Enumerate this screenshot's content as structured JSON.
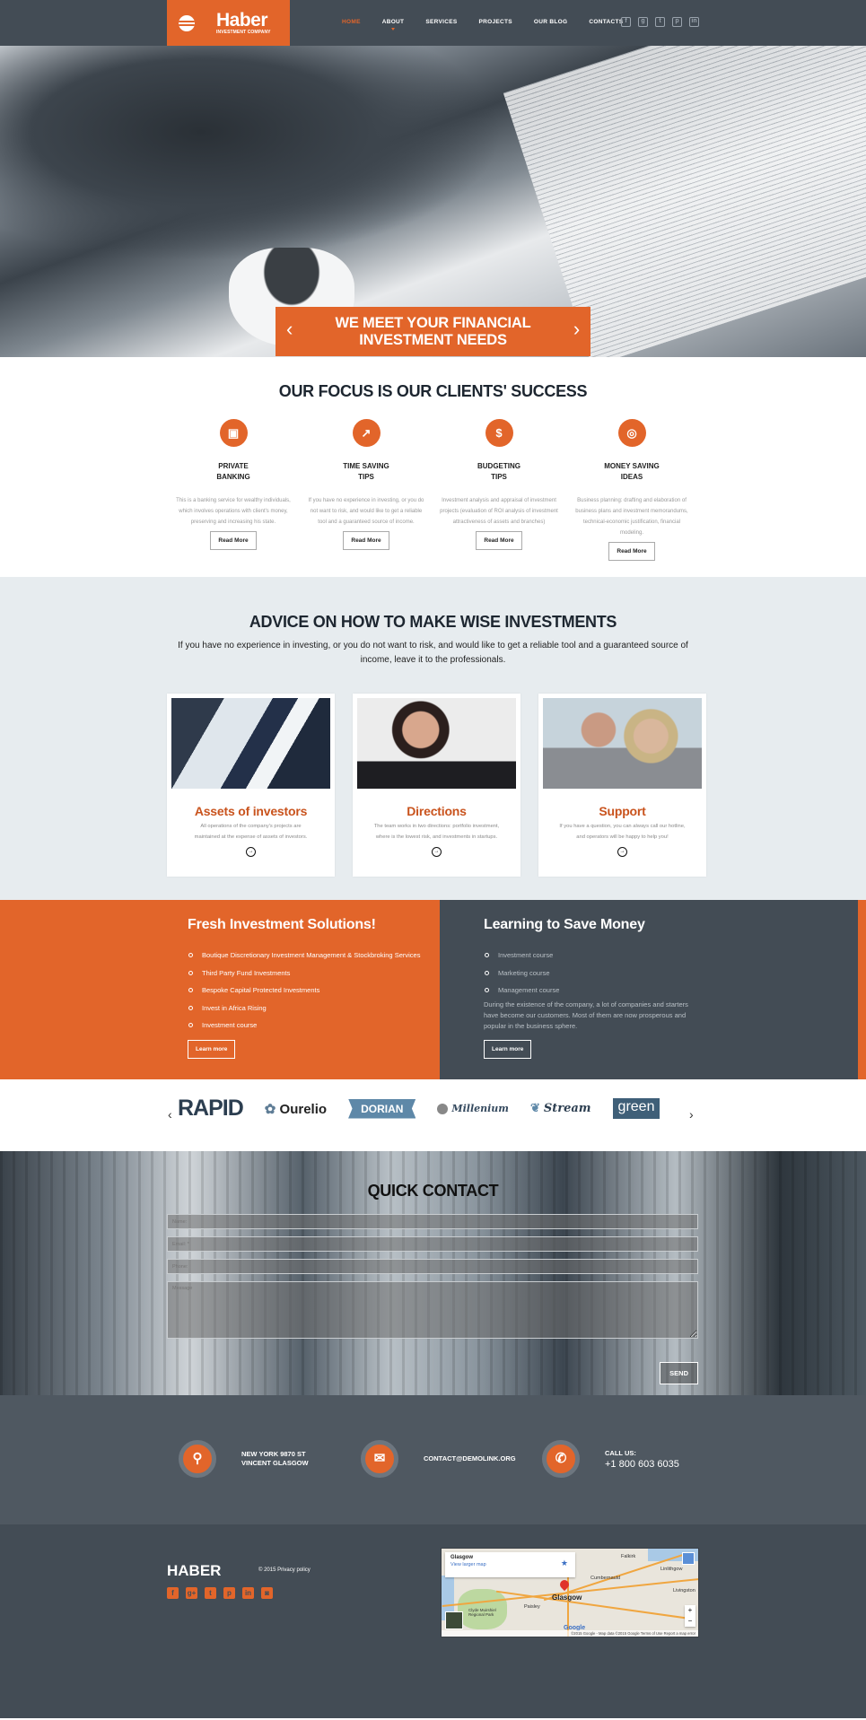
{
  "header": {
    "brand_name": "Haber",
    "brand_tagline": "INVESTMENT COMPANY",
    "nav": [
      {
        "label": "HOME",
        "active": true
      },
      {
        "label": "ABOUT",
        "active": false
      },
      {
        "label": "SERVICES",
        "active": false
      },
      {
        "label": "PROJECTS",
        "active": false
      },
      {
        "label": "OUR BLOG",
        "active": false
      },
      {
        "label": "CONTACTS",
        "active": false
      }
    ],
    "social": [
      {
        "icon": "facebook-icon",
        "glyph": "f"
      },
      {
        "icon": "google-plus-icon",
        "glyph": "g"
      },
      {
        "icon": "twitter-icon",
        "glyph": "t"
      },
      {
        "icon": "pinterest-icon",
        "glyph": "p"
      },
      {
        "icon": "linkedin-icon",
        "glyph": "in"
      }
    ]
  },
  "hero": {
    "banner_line1": "WE MEET YOUR FINANCIAL",
    "banner_line2": "INVESTMENT NEEDS",
    "prev_glyph": "‹",
    "next_glyph": "›"
  },
  "focus": {
    "title": "OUR FOCUS IS OUR CLIENTS' SUCCESS",
    "features": [
      {
        "icon": "wallet-icon",
        "glyph": "▣",
        "title_line1": "PRIVATE",
        "title_line2": "BANKING",
        "text": "This is a banking service for wealthy individuals, which involves operations with client's money, preserving and increasing his state.",
        "button": "Read More"
      },
      {
        "icon": "chart-growth-icon",
        "glyph": "↗",
        "title_line1": "TIME SAVING",
        "title_line2": "TIPS",
        "text": "If you have no experience in investing, or you do not want to risk, and would like to get a reliable tool and a guaranteed source of income.",
        "button": "Read More"
      },
      {
        "icon": "money-bag-icon",
        "glyph": "$",
        "title_line1": "BUDGETING",
        "title_line2": "TIPS",
        "text": "Investment analysis and appraisal of investment projects (evaluation of ROI analysis of investment attractiveness of assets and branches)",
        "button": "Read More"
      },
      {
        "icon": "coins-icon",
        "glyph": "◎",
        "title_line1": "MONEY SAVING",
        "title_line2": "IDEAS",
        "text": "Business planning: drafting and elaboration of business plans and investment memorandums, technical-economic justification, financial modeling.",
        "button": "Read More"
      }
    ]
  },
  "advice": {
    "title": "ADVICE ON HOW TO MAKE WISE INVESTMENTS",
    "subtitle": "If you have no experience in investing, or you do not want to risk, and would like to get a reliable tool and a guaranteed source of income, leave it to the professionals.",
    "cards": [
      {
        "title": "Assets of investors",
        "text": "All operations of the company's projects are maintained at the expense of assets of investors.",
        "image": "businessmen-handshake-photo"
      },
      {
        "title": "Directions",
        "text": "The team works in two directions: portfolio investment, where is the lowest risk, and investments in startups.",
        "image": "woman-on-phone-photo"
      },
      {
        "title": "Support",
        "text": "If you have a question, you can always call our hotline, and operators will be happy to help you!",
        "image": "smiling-couple-photo"
      }
    ],
    "more_glyph": "→"
  },
  "split": {
    "left": {
      "title": "Fresh Investment Solutions!",
      "items": [
        "Boutique Discretionary Investment Management & Stockbroking Services",
        "Third Party Fund Investments",
        "Bespoke Capital Protected Investments",
        "Invest in Africa Rising",
        "Investment course"
      ],
      "button": "Learn more"
    },
    "right": {
      "title": "Learning to Save Money",
      "items": [
        "Investment course",
        "Marketing course",
        "Management course"
      ],
      "text": "During the existence of the company, a lot of companies and starters have become our customers. Most of them are now prosperous and popular in the business sphere.",
      "button": "Learn more"
    }
  },
  "partners": {
    "prev_glyph": "‹",
    "next_glyph": "›",
    "logos": [
      "RAPID",
      "Ourelio",
      "DORIAN",
      "Millenium",
      "Stream",
      "green"
    ]
  },
  "contact": {
    "title": "QUICK CONTACT",
    "name_placeholder": "Name:",
    "email_placeholder": "Email: *",
    "phone_placeholder": "Phone:",
    "message_placeholder": "Message",
    "send": "SEND"
  },
  "info": {
    "address_line1": "NEW YORK 9870 ST",
    "address_line2": "VINCENT GLASGOW",
    "email": "CONTACT@DEMOLINK.ORG",
    "call_label": "CALL US:",
    "phone": "+1 800 603 6035"
  },
  "footer": {
    "brand": "HABER",
    "copyright": "© 2015 Privacy policy",
    "social": [
      {
        "icon": "facebook-icon",
        "glyph": "f"
      },
      {
        "icon": "google-plus-icon",
        "glyph": "g+"
      },
      {
        "icon": "twitter-icon",
        "glyph": "t"
      },
      {
        "icon": "pinterest-icon",
        "glyph": "p"
      },
      {
        "icon": "linkedin-icon",
        "glyph": "in"
      },
      {
        "icon": "instagram-icon",
        "glyph": "◙"
      }
    ],
    "map": {
      "place": "Glasgow",
      "larger_link": "View larger map",
      "city_label": "Glasgow",
      "labels": [
        "Falkirk",
        "Linlithgow",
        "Cumbernauld",
        "Livingston",
        "Paisley",
        "Clyde Muirshiel Regional Park"
      ],
      "attribution": "©2015 Google - Map data ©2015 Google  Terms of Use  Report a map error",
      "logo": "Google"
    }
  }
}
